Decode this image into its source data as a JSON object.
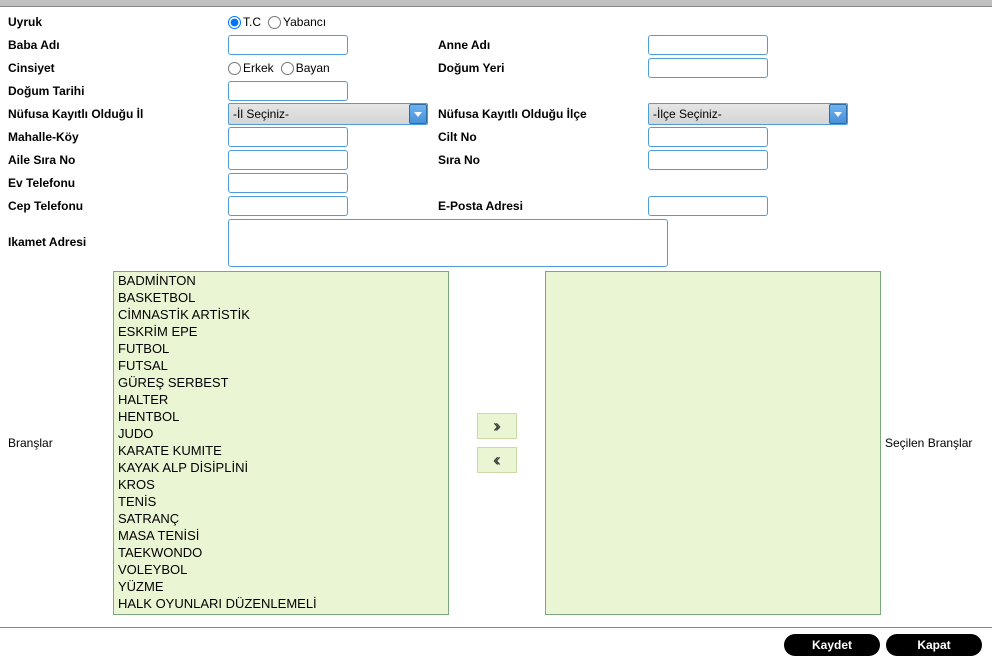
{
  "labels": {
    "uyruk": "Uyruk",
    "baba_adi": "Baba Adı",
    "anne_adi": "Anne Adı",
    "cinsiyet": "Cinsiyet",
    "dogum_yeri": "Doğum Yeri",
    "dogum_tarihi": "Doğum Tarihi",
    "nufus_il": "Nüfusa Kayıtlı Olduğu İl",
    "nufus_ilce": "Nüfusa Kayıtlı Olduğu İlçe",
    "mahalle": "Mahalle-Köy",
    "cilt_no": "Cilt No",
    "aile_sira": "Aile Sıra No",
    "sira_no": "Sıra No",
    "ev_tel": "Ev Telefonu",
    "cep_tel": "Cep Telefonu",
    "eposta": "E-Posta Adresi",
    "ikamet": "Ikamet Adresi",
    "branslar": "Branşlar",
    "secilen": "Seçilen Branşlar"
  },
  "radios": {
    "uyruk": {
      "tc": "T.C",
      "yabanci": "Yabancı",
      "selected": "tc"
    },
    "cinsiyet": {
      "erkek": "Erkek",
      "bayan": "Bayan",
      "selected": ""
    }
  },
  "selects": {
    "il_placeholder": "-İl Seçiniz-",
    "ilce_placeholder": "-İlçe Seçiniz-"
  },
  "values": {
    "baba_adi": "",
    "anne_adi": "",
    "dogum_yeri": "",
    "dogum_tarihi": "",
    "mahalle": "",
    "cilt_no": "",
    "aile_sira": "",
    "sira_no": "",
    "ev_tel": "",
    "cep_tel": "",
    "eposta": "",
    "ikamet": ""
  },
  "branches": [
    "BADMİNTON",
    "BASKETBOL",
    "CİMNASTİK ARTİSTİK",
    "ESKRİM EPE",
    "FUTBOL",
    "FUTSAL",
    "GÜREŞ SERBEST",
    "HALTER",
    "HENTBOL",
    "JUDO",
    "KARATE KUMITE",
    "KAYAK ALP DİSİPLİNİ",
    "KROS",
    "TENİS",
    "SATRANÇ",
    "MASA TENİSİ",
    "TAEKWONDO",
    "VOLEYBOL",
    "YÜZME",
    "HALK OYUNLARI DÜZENLEMELİ"
  ],
  "selected_branches": [],
  "buttons": {
    "kaydet": "Kaydet",
    "kapat": "Kapat",
    "move_right": "››",
    "move_left": "‹‹"
  }
}
